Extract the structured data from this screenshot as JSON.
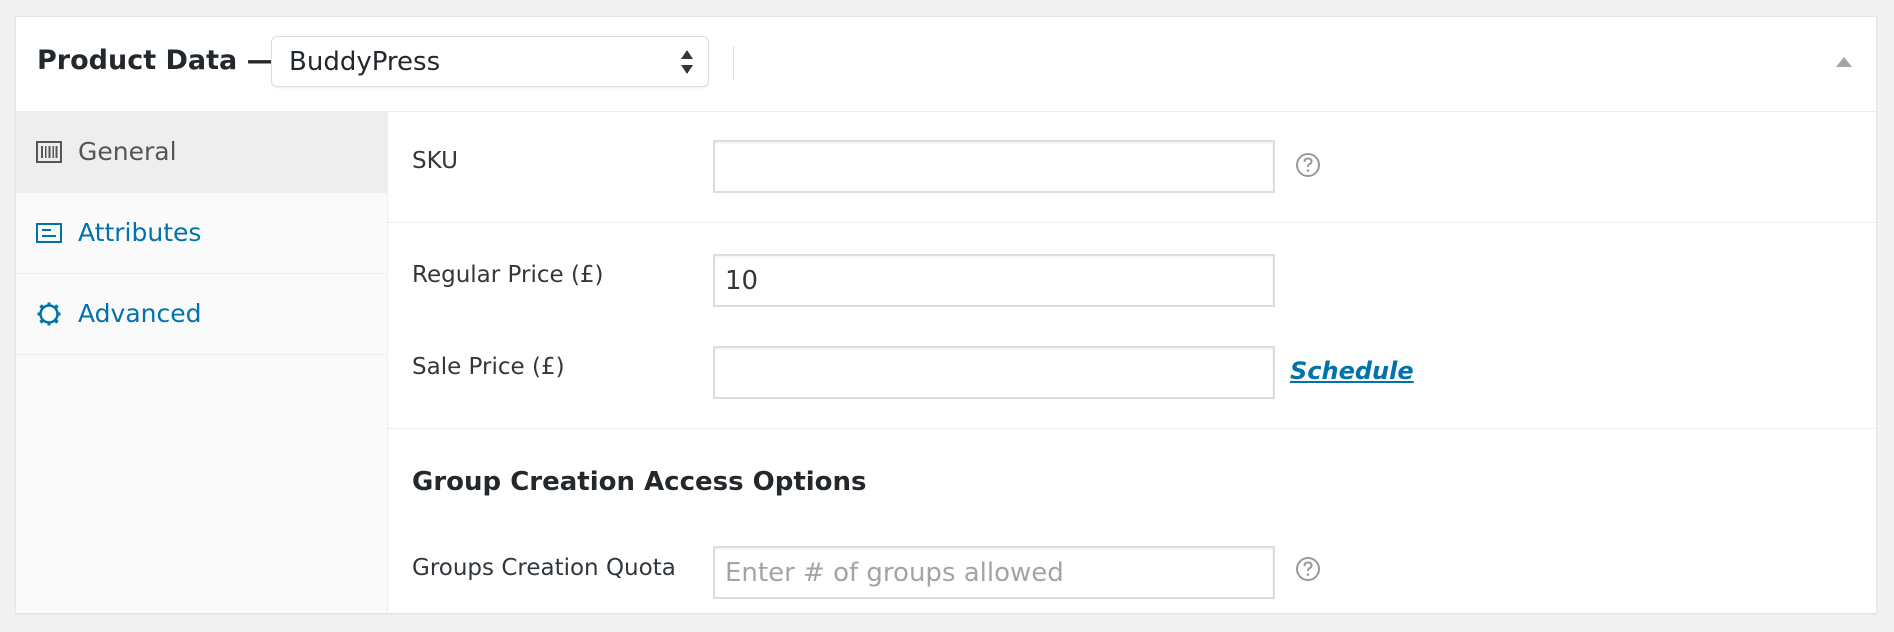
{
  "header": {
    "title": "Product Data —",
    "product_type_select": {
      "selected": "BuddyPress"
    }
  },
  "sidebar": {
    "tabs": [
      {
        "label": "General",
        "icon": "barcode-icon",
        "active": true
      },
      {
        "label": "Attributes",
        "icon": "list-icon",
        "active": false
      },
      {
        "label": "Advanced",
        "icon": "gear-icon",
        "active": false
      }
    ]
  },
  "fields": {
    "sku": {
      "label": "SKU",
      "value": ""
    },
    "regular_price": {
      "label": "Regular Price (£)",
      "value": "10"
    },
    "sale_price": {
      "label": "Sale Price (£)",
      "value": "",
      "schedule_link": "Schedule"
    },
    "group_section_heading": "Group Creation Access Options",
    "groups_quota": {
      "label": "Groups Creation Quota",
      "value": "",
      "placeholder": "Enter # of groups allowed"
    }
  },
  "colors": {
    "link": "#0073aa",
    "active_tab_bg": "#eeeeee",
    "border": "#dddddd"
  }
}
